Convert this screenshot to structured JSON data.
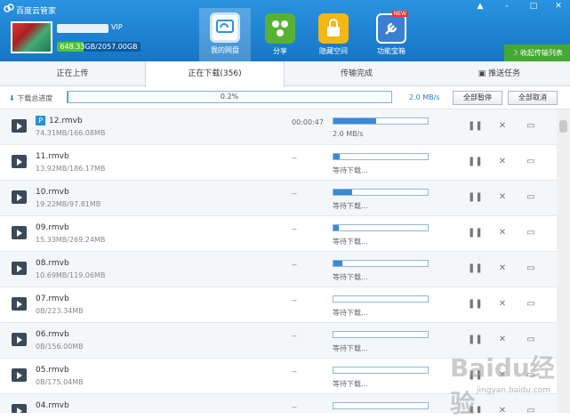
{
  "app": {
    "title": "百度云管家"
  },
  "window": {
    "controls": [
      "▲",
      "–",
      "□",
      "✕"
    ]
  },
  "user": {
    "vip_label": "VIP",
    "quota_text": "648.33GB/2057.00GB",
    "quota_fraction": 0.315
  },
  "nav": [
    {
      "label": "我的网盘",
      "icon": "cloud-icon",
      "color": "#2a93e0"
    },
    {
      "label": "分享",
      "icon": "share-icon",
      "color": "#58b134"
    },
    {
      "label": "隐藏空间",
      "icon": "lock-icon",
      "color": "#f3b716"
    },
    {
      "label": "功能宝箱",
      "icon": "toolbox-icon",
      "color": "#3a7fd0",
      "badge": "NEW"
    }
  ],
  "collapse_label": "收起传输列表",
  "tabs": [
    "正在上传",
    "正在下载(356)",
    "传输完成",
    "推送任务"
  ],
  "toolbar": {
    "total_label": "下载总进度",
    "total_percent": "0.2%",
    "total_fraction": 0.002,
    "speed": "2.0 MB/s",
    "pause_all": "全部暂停",
    "cancel_all": "全部取消"
  },
  "rows": [
    {
      "name": "12.rmvb",
      "size": "74.31MB/166.08MB",
      "eta": "00:00:47",
      "progress": 0.45,
      "status": "2.0 MB/s",
      "ptag": "P"
    },
    {
      "name": "11.rmvb",
      "size": "13.92MB/186.17MB",
      "eta": "--",
      "progress": 0.07,
      "status": "等待下载..."
    },
    {
      "name": "10.rmvb",
      "size": "19.22MB/97.81MB",
      "eta": "--",
      "progress": 0.2,
      "status": "等待下载..."
    },
    {
      "name": "09.rmvb",
      "size": "15.33MB/269.24MB",
      "eta": "--",
      "progress": 0.06,
      "status": "等待下载..."
    },
    {
      "name": "08.rmvb",
      "size": "10.69MB/119.06MB",
      "eta": "--",
      "progress": 0.09,
      "status": "等待下载..."
    },
    {
      "name": "07.rmvb",
      "size": "0B/223.34MB",
      "eta": "--",
      "progress": 0,
      "status": "等待下载..."
    },
    {
      "name": "06.rmvb",
      "size": "0B/156.00MB",
      "eta": "--",
      "progress": 0,
      "status": "等待下载..."
    },
    {
      "name": "05.rmvb",
      "size": "0B/175.04MB",
      "eta": "--",
      "progress": 0,
      "status": "等待下载..."
    },
    {
      "name": "04.rmvb",
      "size": "",
      "eta": "--",
      "progress": 0,
      "status": ""
    }
  ],
  "watermark": {
    "main": "Baidu经验",
    "sub": "jingyan.baidu.com"
  }
}
